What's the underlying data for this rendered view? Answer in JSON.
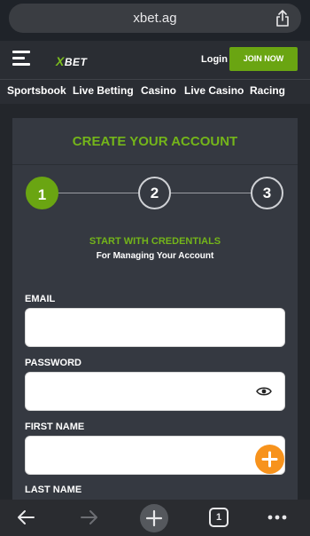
{
  "browser": {
    "url": "xbet.ag"
  },
  "header": {
    "logo_text": "XBET",
    "login_label": "Login",
    "join_label": "JOIN NOW"
  },
  "nav": {
    "items": [
      "Sportsbook",
      "Live Betting",
      "Casino",
      "Live Casino",
      "Racing"
    ]
  },
  "form": {
    "title": "CREATE YOUR ACCOUNT",
    "steps": [
      "1",
      "2",
      "3"
    ],
    "active_step": 1,
    "subtitle": "START WITH CREDENTIALS",
    "caption": "For Managing Your Account",
    "fields": {
      "email": {
        "label": "EMAIL",
        "value": ""
      },
      "password": {
        "label": "PASSWORD",
        "value": ""
      },
      "first_name": {
        "label": "FIRST NAME",
        "value": ""
      },
      "last_name": {
        "label": "LAST NAME"
      }
    }
  },
  "toolbar": {
    "tab_count": "1"
  },
  "colors": {
    "brand_green": "#6aa512",
    "accent_orange": "#f7931d"
  }
}
